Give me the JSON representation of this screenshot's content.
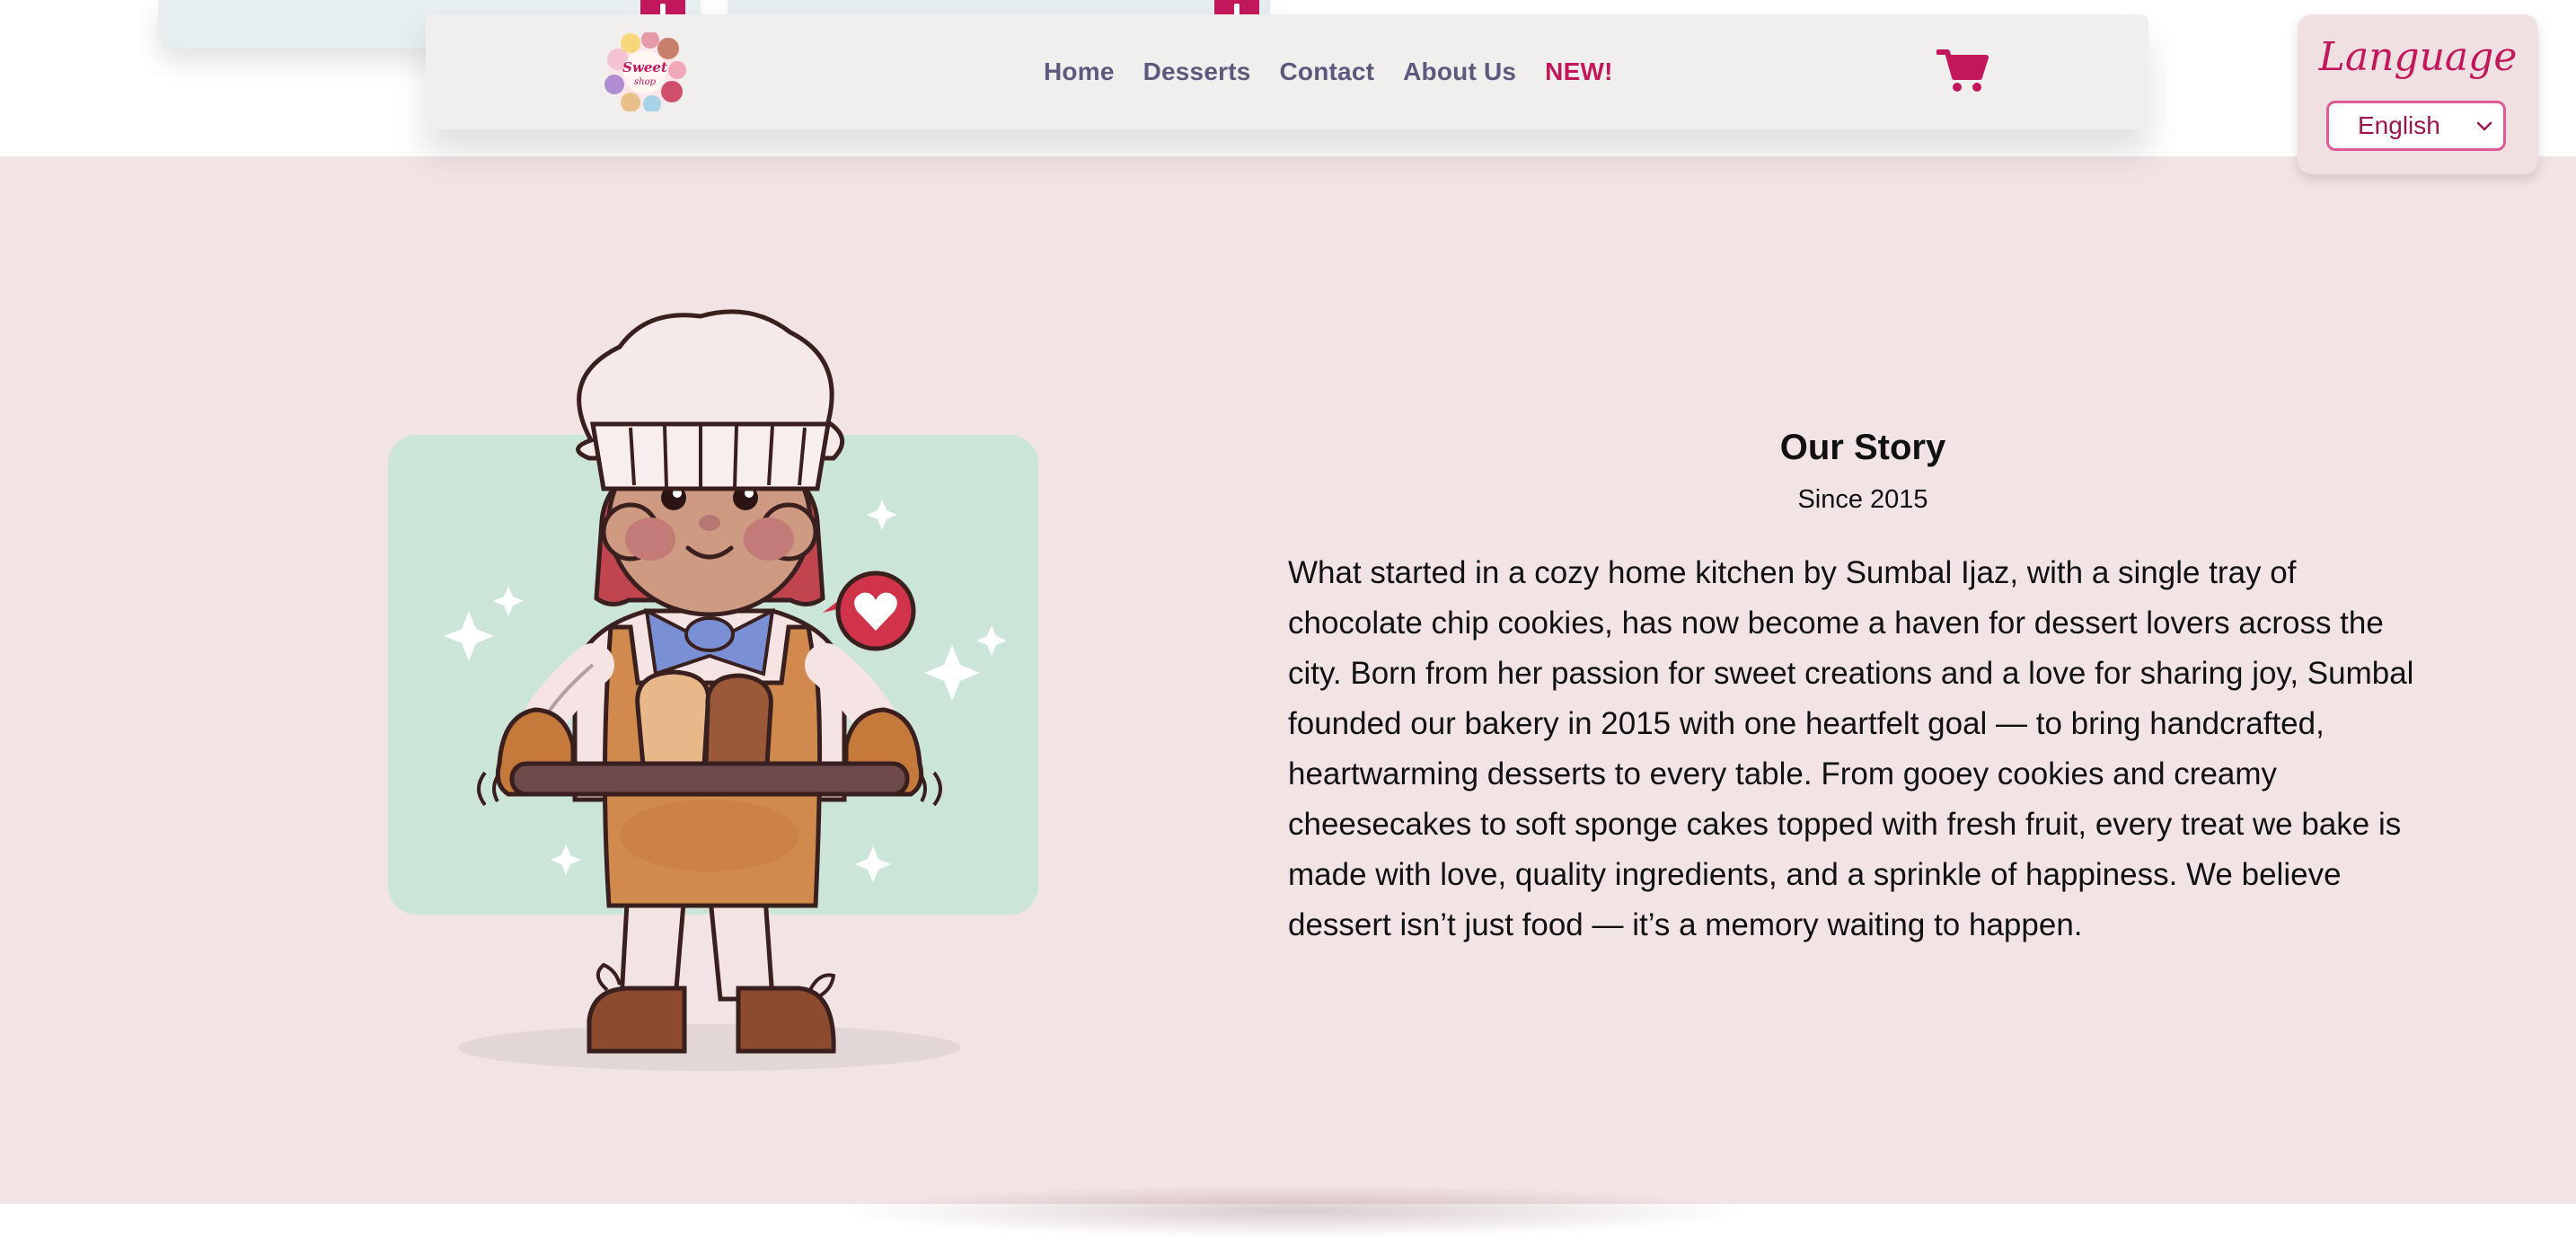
{
  "nav": {
    "logo_text": "Sweet shop",
    "links": [
      {
        "label": "Home"
      },
      {
        "label": "Desserts"
      },
      {
        "label": "Contact"
      },
      {
        "label": "About Us"
      },
      {
        "label": "NEW!"
      }
    ],
    "cart_icon": "shopping-cart-icon"
  },
  "language": {
    "title": "Language",
    "selected": "English",
    "chevron_icon": "chevron-down-icon"
  },
  "story": {
    "title": "Our Story",
    "since": "Since 2015",
    "body": "What started in a cozy home kitchen by Sumbal Ijaz, with a single tray of chocolate chip cookies, has now become a haven for dessert lovers across the city. Born from her passion for sweet creations and a love for sharing joy, Sumbal founded our bakery in 2015 with one heartfelt goal — to bring handcrafted, heartwarming desserts to every table. From gooey cookies and creamy cheesecakes to soft sponge cakes topped with fresh fruit, every treat we bake is made with love, quality ingredients, and a sprinkle of happiness. We believe dessert isn’t just food — it’s a memory waiting to happen."
  },
  "colors": {
    "accent": "#c2185b",
    "nav_text": "#5b5a7e",
    "section_bg": "#f2e4e5",
    "mint": "#cce5d9"
  }
}
